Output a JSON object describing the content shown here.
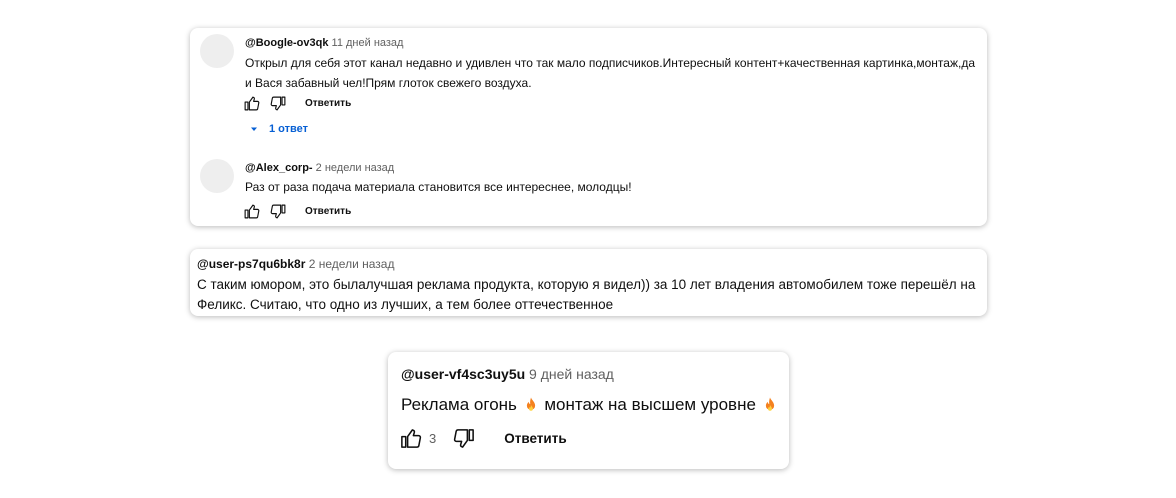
{
  "comments": [
    {
      "author": "@Boogle-ov3qk",
      "time": "11 дней назад",
      "text": "Открыл для себя этот канал недавно и удивлен что так мало подписчиков.Интересный контент+качественная картинка,монтаж,да и Вася забавный чел!Прям глоток свежего воздуха.",
      "reply_label": "Ответить",
      "replies_toggle": "1 ответ"
    },
    {
      "author": "@Alex_corp-",
      "time": "2 недели назад",
      "text": "Раз от раза подача материала становится все интереснее, молодцы!",
      "reply_label": "Ответить"
    },
    {
      "author": "@user-ps7qu6bk8r",
      "time": "2 недели назад",
      "text": "С таким юмором, это былалучшая реклама продукта, которую я видел)) за 10 лет владения автомобилем тоже перешёл на Феликс. Считаю, что одно из лучших, а тем более оттечественное"
    },
    {
      "author": "@user-vf4sc3uy5u",
      "time": "9 дней назад",
      "text_part1": "Реклама огонь ",
      "text_part2": " монтаж на высшем уровне ",
      "likes": "3",
      "reply_label": "Ответить"
    }
  ],
  "icons": {
    "like": "thumbs-up-icon",
    "dislike": "thumbs-down-icon",
    "fire": "fire-emoji",
    "expand": "caret-down-icon"
  },
  "colors": {
    "link_blue": "#065fd4",
    "meta_gray": "#606060",
    "avatar_gray": "#eeeeee"
  }
}
